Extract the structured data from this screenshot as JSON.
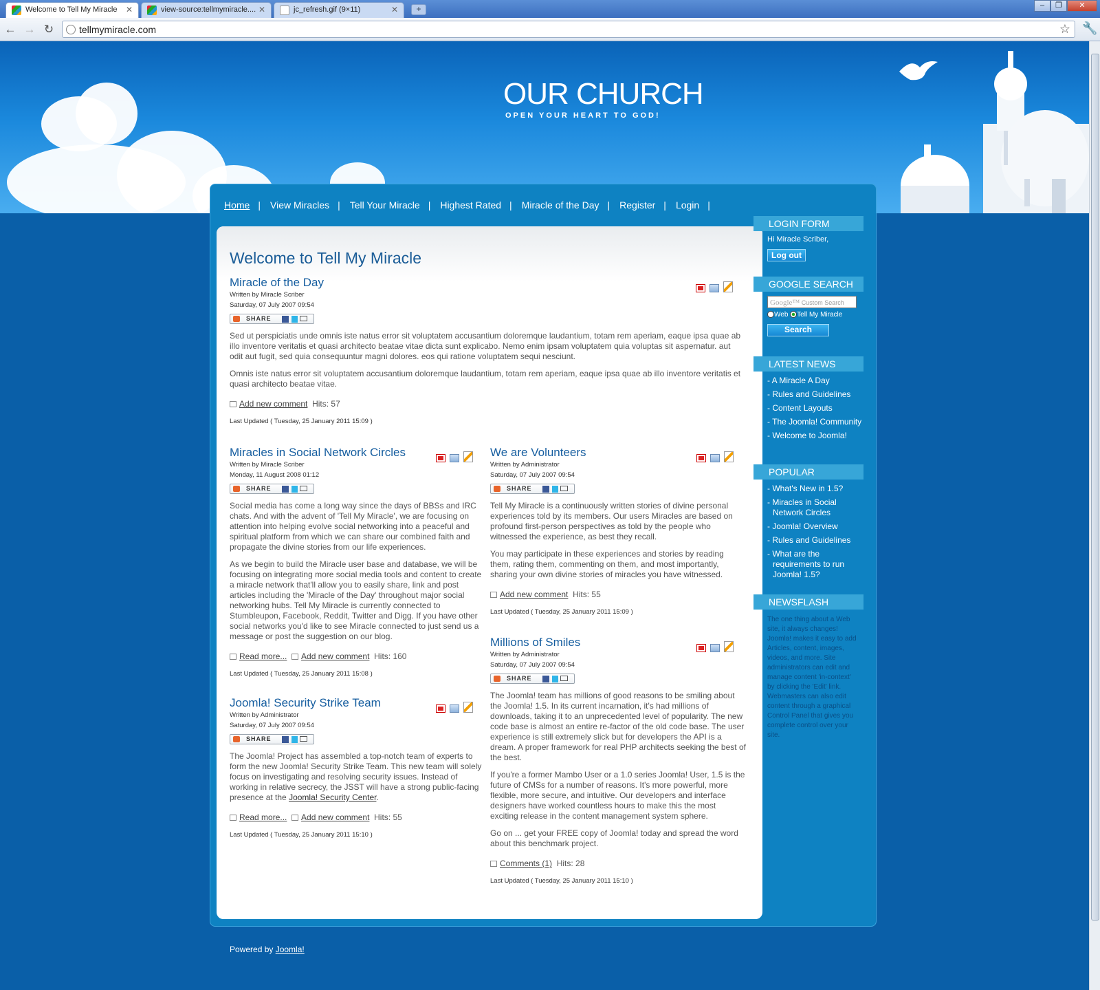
{
  "browser": {
    "tabs": [
      {
        "title": "Welcome to Tell My Miracle"
      },
      {
        "title": "view-source:tellmymiracle...."
      },
      {
        "title": "jc_refresh.gif (9×11)"
      }
    ],
    "new_tab_label": "+",
    "address": "tellmymiracle.com",
    "window_buttons": {
      "minimize": "–",
      "maximize": "❐",
      "close": "✕"
    },
    "nav": {
      "back": "←",
      "forward": "→",
      "reload": "↻"
    },
    "star": "☆",
    "wrench": "🔧"
  },
  "site": {
    "title": "OUR CHURCH",
    "slogan": "OPEN YOUR HEART TO GOD!"
  },
  "topnav": [
    {
      "label": "Home"
    },
    {
      "label": "View Miracles"
    },
    {
      "label": "Tell Your Miracle"
    },
    {
      "label": "Highest Rated"
    },
    {
      "label": "Miracle of the Day"
    },
    {
      "label": "Register"
    },
    {
      "label": "Login"
    }
  ],
  "topnav_sep": "|",
  "page_title": "Welcome to Tell My Miracle",
  "share_label": "SHARE",
  "articles": [
    {
      "title": "Miracle of the Day",
      "author": "Written by Miracle Scriber",
      "date": "Saturday, 07 July 2007 09:54",
      "paragraphs": [
        "Sed ut perspiciatis unde omnis iste natus error sit voluptatem accusantium doloremque laudantium, totam rem aperiam, eaque ipsa quae ab illo inventore veritatis et quasi architecto beatae vitae dicta sunt explicabo. Nemo enim ipsam voluptatem quia voluptas sit aspernatur. aut odit aut fugit, sed quia consequuntur magni dolores. eos qui ratione voluptatem sequi nesciunt.",
        "Omnis iste natus error sit voluptatem accusantium doloremque laudantium, totam rem aperiam, eaque ipsa quae ab illo inventore veritatis et quasi architecto beatae vitae."
      ],
      "comment_link": "Add new comment",
      "hits": "Hits: 57",
      "updated": "Last Updated ( Tuesday, 25 January 2011 15:09 )"
    },
    {
      "title": "Miracles in Social Network Circles",
      "author": "Written by Miracle Scriber",
      "date": "Monday, 11 August 2008 01:12",
      "paragraphs": [
        "Social media has come a long way since the days of BBSs and IRC chats. And with the advent of 'Tell My Miracle', we are focusing on attention into helping evolve social networking into a peaceful and spiritual platform from which we can share our combined faith and propagate the divine stories from our life experiences.",
        "As we begin to build the Miracle user base and database, we will be focusing on integrating more social media tools and content to create a miracle network that'll allow you to easily share, link and post articles including the 'Miracle of the Day' throughout major social networking hubs. Tell My Miracle is currently connected to Stumbleupon, Facebook, Reddit, Twitter and Digg. If you have other social networks you'd like to see Miracle connected to just send us a message or post the suggestion on our blog."
      ],
      "readmore": "Read more...",
      "comment_link": "Add new comment",
      "hits": "Hits: 160",
      "updated": "Last Updated ( Tuesday, 25 January 2011 15:08 )"
    },
    {
      "title": "Joomla! Security Strike Team",
      "author": "Written by Administrator",
      "date": "Saturday, 07 July 2007 09:54",
      "paragraph_before": "The Joomla! Project has assembled a top-notch team of experts to form the new Joomla! Security Strike Team. This new team will solely focus on investigating and resolving security issues. Instead of working in relative secrecy, the JSST will have a strong public-facing presence at the ",
      "link": "Joomla! Security Center",
      "paragraph_after": ".",
      "readmore": "Read more...",
      "comment_link": "Add new comment",
      "hits": "Hits: 55",
      "updated": "Last Updated ( Tuesday, 25 January 2011 15:10 )"
    },
    {
      "title": "We are Volunteers",
      "author": "Written by Administrator",
      "date": "Saturday, 07 July 2007 09:54",
      "paragraphs": [
        "Tell My Miracle is a continuously written stories of divine personal experiences told by its members. Our users Miracles are based on profound first-person perspectives as told by the people who witnessed the experience, as best they recall.",
        "You may participate in these experiences and stories by reading them, rating them, commenting on them, and most importantly, sharing your own divine stories of miracles you have witnessed."
      ],
      "comment_link": "Add new comment",
      "hits": "Hits: 55",
      "updated": "Last Updated ( Tuesday, 25 January 2011 15:09 )"
    },
    {
      "title": "Millions of Smiles",
      "author": "Written by Administrator",
      "date": "Saturday, 07 July 2007 09:54",
      "paragraphs": [
        "The Joomla! team has millions of good reasons to be smiling about the Joomla! 1.5. In its current incarnation, it's had millions of downloads, taking it to an unprecedented level of popularity. The new code base is almost an entire re-factor of the old code base. The user experience is still extremely slick but for developers the API is a dream. A proper framework for real PHP architects seeking the best of the best.",
        "If you're a former Mambo User or a 1.0 series Joomla! User, 1.5 is the future of CMSs for a number of reasons. It's more powerful, more flexible, more secure, and intuitive. Our developers and interface designers have worked countless hours to make this the most exciting release in the content management system sphere.",
        "Go on ... get your FREE copy of Joomla! today and spread the word about this benchmark project."
      ],
      "comment_link": "Comments (1)",
      "hits": "Hits: 28",
      "updated": "Last Updated ( Tuesday, 25 January 2011 15:10 )"
    }
  ],
  "sidebar": {
    "login": {
      "heading": "LOGIN FORM",
      "greeting": "Hi Miracle Scriber,",
      "button": "Log out"
    },
    "google": {
      "heading": "GOOGLE SEARCH",
      "brand": "Google™",
      "placeholder": "Custom Search",
      "opt_web": "Web",
      "opt_site": "Tell My Miracle",
      "button": "Search"
    },
    "latest": {
      "heading": "LATEST NEWS",
      "items": [
        "A Miracle A Day",
        "Rules and Guidelines",
        "Content Layouts",
        "The Joomla! Community",
        "Welcome to Joomla!"
      ]
    },
    "popular": {
      "heading": "POPULAR",
      "items": [
        "What's New in 1.5?",
        "Miracles in Social Network Circles",
        "Joomla! Overview",
        "Rules and Guidelines",
        "What are the requirements to run Joomla! 1.5?"
      ]
    },
    "newsflash": {
      "heading": "NEWSFLASH",
      "text": "The one thing about a Web site, it always changes! Joomla! makes it easy to add Articles, content, images, videos, and more. Site administrators can edit and manage content 'in-context' by clicking the 'Edit' link. Webmasters can also edit content through a graphical Control Panel that gives you complete control over your site."
    }
  },
  "footer": {
    "text": "Powered by ",
    "link": "Joomla!"
  },
  "colors": {
    "page_bg": "#0a5fa8",
    "container": "#0e82c2",
    "module_header": "#37a6d8",
    "title_blue": "#155d9f"
  }
}
